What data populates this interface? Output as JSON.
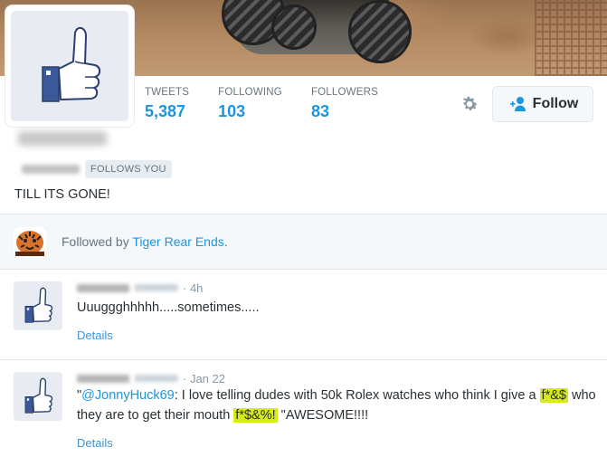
{
  "profile": {
    "stats": [
      {
        "label": "TWEETS",
        "value": "5,387"
      },
      {
        "label": "FOLLOWING",
        "value": "103"
      },
      {
        "label": "FOLLOWERS",
        "value": "83"
      }
    ],
    "follow_label": "Follow",
    "follows_you_badge": "FOLLOWS YOU",
    "bio": "TILL ITS GONE!"
  },
  "followed_by": {
    "prefix": "Followed by ",
    "name": "Tiger Rear Ends",
    "suffix": "."
  },
  "tweets": [
    {
      "time": "· 4h",
      "text": "Uuuggghhhhh.....sometimes.....",
      "details_label": "Details"
    },
    {
      "time": "· Jan 22",
      "quote_open": "\"",
      "mention": "@JonnyHuck69",
      "text_part1": ": I love telling dudes with 50k Rolex watches who think I give a",
      "highlight1": "f*&$",
      "text_part2": " who they are to get their mouth ",
      "highlight2": "f*$&%!",
      "text_part3": " \"AWESOME!!!!",
      "details_label": "Details"
    }
  ],
  "colors": {
    "link": "#1b95e0",
    "highlight": "#d7eb1b",
    "muted": "#66757f"
  },
  "icons": {
    "avatar": "thumb-middle-finger-icon",
    "settings": "gear-icon",
    "follow": "add-user-icon"
  }
}
